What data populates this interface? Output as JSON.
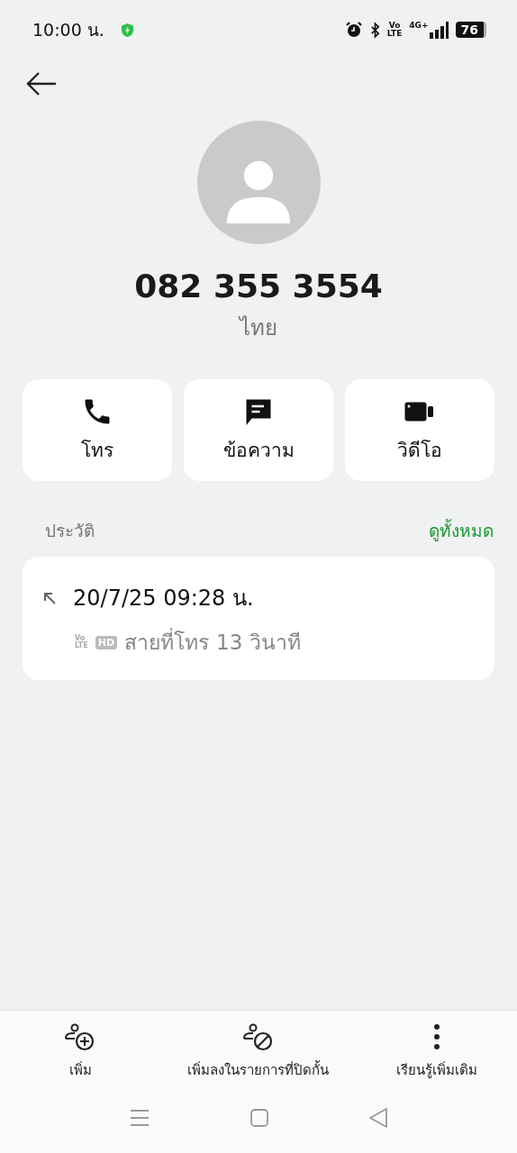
{
  "status_bar": {
    "time": "10:00 น.",
    "volte_top": "Vo",
    "volte_bottom": "LTE",
    "network": "4G+",
    "battery": "76"
  },
  "contact": {
    "number": "082 355 3554",
    "location": "ไทย"
  },
  "actions": [
    {
      "kind": "call",
      "label": "โทร"
    },
    {
      "kind": "message",
      "label": "ข้อความ"
    },
    {
      "kind": "video",
      "label": "วิดีโอ"
    }
  ],
  "history": {
    "title": "ประวัติ",
    "view_all": "ดูทั้งหมด",
    "entries": [
      {
        "kind": "outgoing",
        "datetime": "20/7/25 09:28 น.",
        "volte_top": "Vo",
        "volte_bottom": "LTE",
        "hd": "HD",
        "type": "สายที่โทร",
        "duration": "13 วินาที"
      }
    ]
  },
  "bottom_actions": [
    {
      "kind": "add",
      "label": "เพิ่ม"
    },
    {
      "kind": "block",
      "label": "เพิ่มลงในรายการที่ปิดกั้น"
    },
    {
      "kind": "more",
      "label": "เรียนรู้เพิ่มเติม"
    }
  ]
}
